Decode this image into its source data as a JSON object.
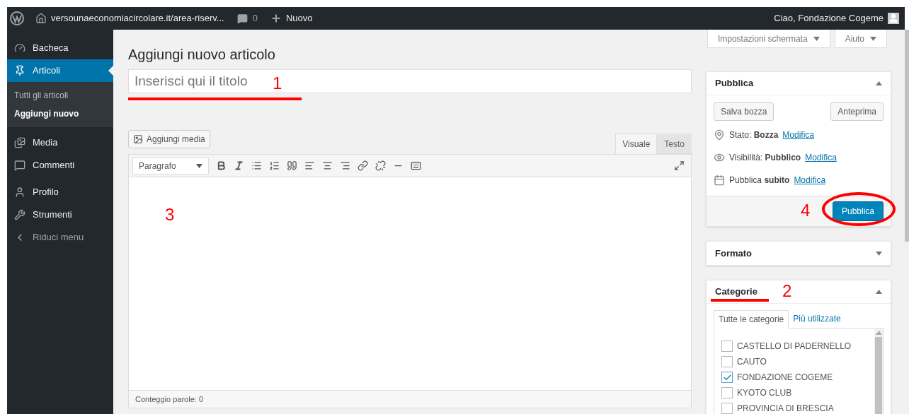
{
  "admin_bar": {
    "site": "versounaeconomiacircolare.it/area-riserv...",
    "comments": "0",
    "new": "Nuovo",
    "greeting": "Ciao, Fondazione Cogeme"
  },
  "sidebar": {
    "items": [
      {
        "label": "Bacheca",
        "selected": false
      },
      {
        "label": "Articoli",
        "selected": true,
        "children": [
          {
            "label": "Tutti gli articoli",
            "selected": false
          },
          {
            "label": "Aggiungi nuovo",
            "selected": true
          }
        ]
      },
      {
        "label": "Media",
        "selected": false
      },
      {
        "label": "Commenti",
        "selected": false
      },
      {
        "label": "Profilo",
        "selected": false
      },
      {
        "label": "Strumenti",
        "selected": false
      },
      {
        "label": "Riduci menu",
        "selected": false
      }
    ]
  },
  "screen_tabs": [
    "Impostazioni schermata",
    "Aiuto"
  ],
  "page_title": "Aggiungi nuovo articolo",
  "title_field": {
    "placeholder": "Inserisci qui il titolo"
  },
  "add_media": "Aggiungi media",
  "editor_tabs": [
    {
      "label": "Visuale",
      "selected": true
    },
    {
      "label": "Testo",
      "selected": false
    }
  ],
  "format_select": "Paragrafo",
  "word_count": "Conteggio parole: 0",
  "publish_box": {
    "title": "Pubblica",
    "expanded": true,
    "save_draft": "Salva bozza",
    "preview": "Anteprima",
    "rows": [
      {
        "label": "Stato: **Bozza**",
        "link": "Modifica"
      },
      {
        "label": "Visibilità: **Pubblico**",
        "link": "Modifica"
      },
      {
        "label": "Pubblica **subito**",
        "link": "Modifica"
      }
    ],
    "publish_button": "Pubblica"
  },
  "format_box": {
    "title": "Formato",
    "expanded": false
  },
  "categories_box": {
    "title": "Categorie",
    "expanded": true,
    "tabs": [
      {
        "label": "Tutte le categorie",
        "selected": true
      },
      {
        "label": "Più utilizzate",
        "selected": false
      }
    ],
    "items": [
      {
        "label": "CASTELLO DI PADERNELLO",
        "checked": false
      },
      {
        "label": "CAUTO",
        "checked": false
      },
      {
        "label": "FONDAZIONE COGEME",
        "checked": true
      },
      {
        "label": "KYOTO CLUB",
        "checked": false
      },
      {
        "label": "PROVINCIA DI BRESCIA",
        "checked": false
      }
    ]
  },
  "annotations": [
    "1",
    "2",
    "3",
    "4"
  ]
}
